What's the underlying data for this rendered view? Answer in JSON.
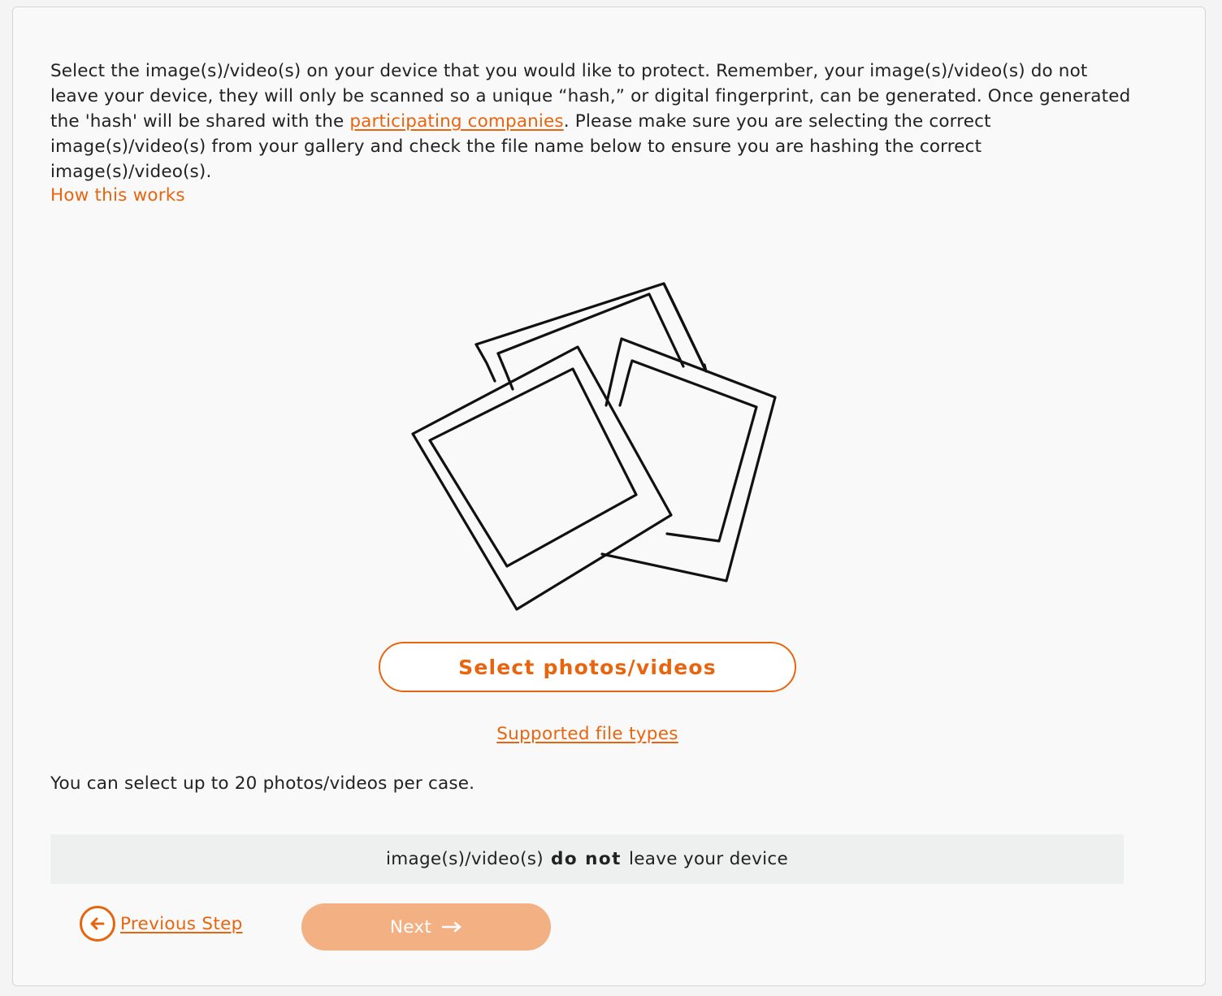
{
  "intro": {
    "text_before_link": "Select the image(s)/video(s) on your device that you would like to protect. Remember, your image(s)/video(s) do not leave your device, they will only be scanned so a unique “hash,” or digital fingerprint, can be generated. Once generated the 'hash' will be shared with the ",
    "link_label": "participating companies",
    "text_after_link": ". Please make sure you are selecting the correct image(s)/video(s) from your gallery and check the file name below to ensure you are hashing the correct image(s)/video(s)."
  },
  "how_this_works_label": "How this works",
  "illustration_icon": "photos-stack-illustration",
  "select_button_label": "Select photos/videos",
  "supported_file_types_label": "Supported file types",
  "limit_text": "You can select up to 20 photos/videos per case.",
  "notice": {
    "prefix": "image(s)/video(s)",
    "emphasis": "do not",
    "suffix": "leave your device"
  },
  "nav": {
    "previous_label": "Previous Step",
    "previous_icon": "arrow-left-circle-icon",
    "next_label": "Next",
    "next_icon": "arrow-right-icon"
  },
  "colors": {
    "accent": "#e8650f",
    "next_button_disabled": "#f2b083",
    "notice_background": "#eeefef",
    "card_background": "#f9f9f9"
  }
}
